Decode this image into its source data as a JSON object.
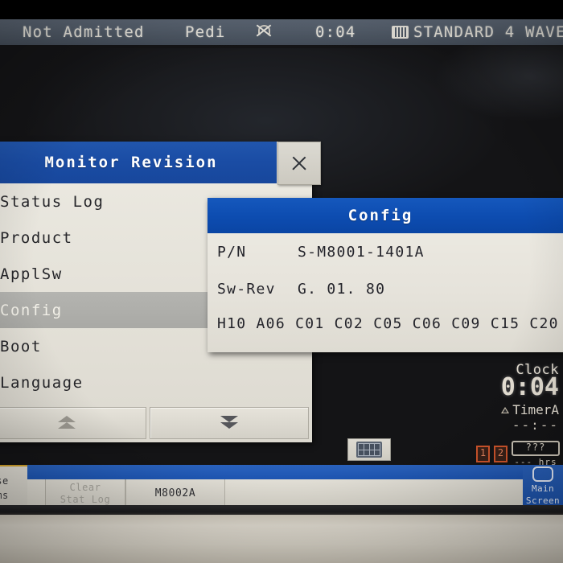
{
  "status_bar": {
    "patient_status": "Not Admitted",
    "patient_category": "Pedi",
    "alarm_icon": "bell-off-icon",
    "elapsed_time": "0:04",
    "screen_icon": "wave-screen-icon",
    "screen_label": "STANDARD 4 WAVE"
  },
  "monitor_revision_dialog": {
    "title": "Monitor Revision",
    "close_icon": "close-x-icon",
    "menu_items": [
      {
        "label": "Status Log",
        "selected": false
      },
      {
        "label": "Product",
        "selected": false
      },
      {
        "label": "ApplSw",
        "selected": false
      },
      {
        "label": "Config",
        "selected": true
      },
      {
        "label": "Boot",
        "selected": false
      },
      {
        "label": "Language",
        "selected": false
      }
    ],
    "scroll_up_icon": "double-chevron-up-icon",
    "scroll_down_icon": "double-chevron-down-icon"
  },
  "config_dialog": {
    "title": "Config",
    "rows": [
      {
        "key": "P/N",
        "value": "S-M8001-1401A"
      },
      {
        "key": "Sw-Rev",
        "value": "G. 01. 80"
      }
    ],
    "option_codes": "H10 A06 C01 C02 C05 C06 C09 C15 C20"
  },
  "clock_panel": {
    "clock_label": "Clock",
    "clock_value": "0:04",
    "timer_label": "TimerA",
    "timer_icon": "triangle-alert-icon",
    "timer_value": "--:--"
  },
  "battery_panel": {
    "slot_1": "1",
    "slot_2": "2",
    "charge_text": "???",
    "hours_text": "--- hrs"
  },
  "keyboard_button": {
    "icon": "keyboard-icon"
  },
  "toolbar": {
    "clear_stat_log_line1": "Clear",
    "clear_stat_log_line2": "Stat Log",
    "module_label": "M8002A",
    "main_screen_line1": "Main",
    "main_screen_line2": "Screen",
    "main_screen_icon": "screen-icon",
    "left_cut_line1": "se",
    "left_cut_line2": "ms"
  },
  "colors": {
    "title_blue": "#1a4ca4",
    "config_blue": "#0d4cb0",
    "dialog_grey": "#e7e5dd",
    "selected_grey": "#aeaea9",
    "battery_orange": "#d2562c",
    "toolbar_blue": "#1d55b2"
  }
}
